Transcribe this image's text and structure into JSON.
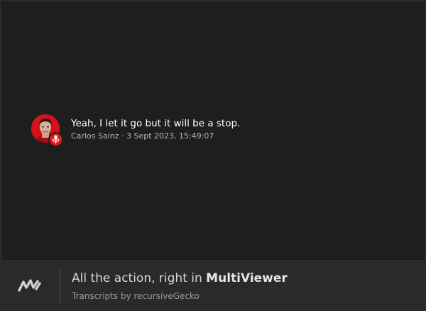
{
  "transcript": {
    "messages": [
      {
        "text": "Yeah, I let it go but it will be a stop.",
        "author": "Carlos Sainz",
        "separator": "·",
        "timestamp": "3 Sept 2023, 15:49:07",
        "avatar_color": "#d6121a",
        "badge_icon": "microphone-icon"
      }
    ]
  },
  "footer": {
    "logo_icon": "multiviewer-logo-icon",
    "tagline_prefix": "All the action, right in ",
    "tagline_brand": "MultiViewer",
    "credit": "Transcripts by recursiveGecko"
  },
  "colors": {
    "background": "#1e1e1f",
    "footer_background": "#2a2a2b",
    "accent_red": "#e21b22"
  }
}
